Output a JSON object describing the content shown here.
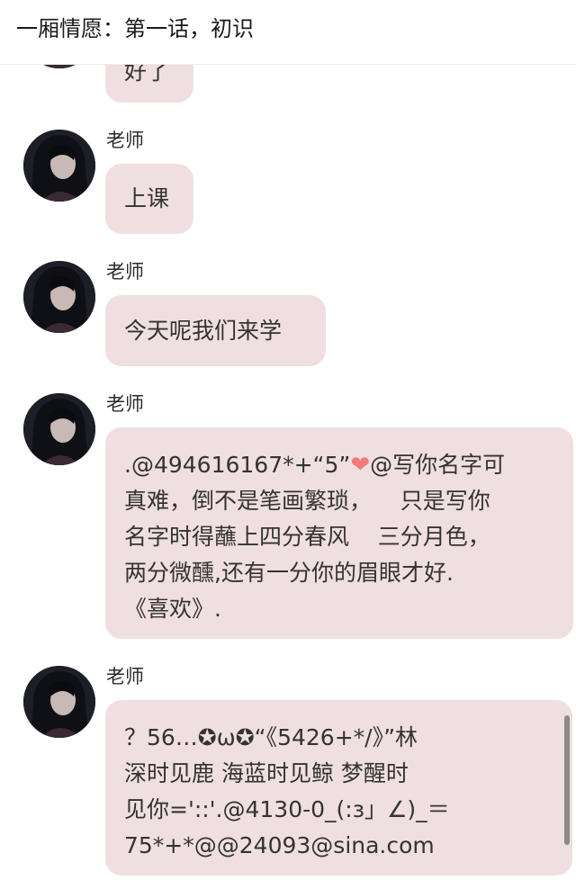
{
  "header": {
    "title": "一厢情愿：第一话，初识"
  },
  "messages": [
    {
      "sender": "",
      "text": "好了"
    },
    {
      "sender": "老师",
      "text": "上课"
    },
    {
      "sender": "老师",
      "text": "今天呢我们来学"
    },
    {
      "sender": "老师",
      "line1a": ".@494616167*+“5”",
      "heart": "❤",
      "line1b": "@写你名字可",
      "lines_rest": "真难，倒不是笔画繁琐，    只是写你\n名字时得蘸上四分春风    三分月色，\n两分微醺,还有一分你的眉眼才好.\n《喜欢》."
    },
    {
      "sender": "老师",
      "text": "？56…✪ω✪“《5426+*/》”林\n深时见鹿 海蓝时见鲸 梦醒时\n见你='::'.@4130-0_(:з」∠)_＝\n75*+*@@24093@sina.com"
    }
  ],
  "colors": {
    "bubble": "#f0dfe0",
    "heart": "#f07a7c"
  }
}
